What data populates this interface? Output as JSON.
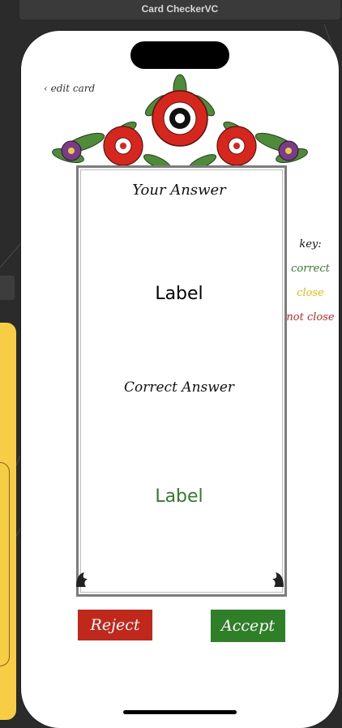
{
  "window": {
    "title": "Card CheckerVC"
  },
  "nav": {
    "edit_card": "‹ edit card"
  },
  "card": {
    "your_answer_title": "Your Answer",
    "your_answer_value": "Label",
    "correct_answer_title": "Correct Answer",
    "correct_answer_value": "Label"
  },
  "key": {
    "title": "key:",
    "correct": "correct",
    "close": "close",
    "not_close": "not close",
    "colors": {
      "correct": "#2f7f28",
      "close": "#f1b800",
      "not_close": "#d9241c"
    }
  },
  "buttons": {
    "reject": "Reject",
    "accept": "Accept"
  },
  "colors": {
    "reject": "#c0281c",
    "accept": "#2f7f28"
  }
}
